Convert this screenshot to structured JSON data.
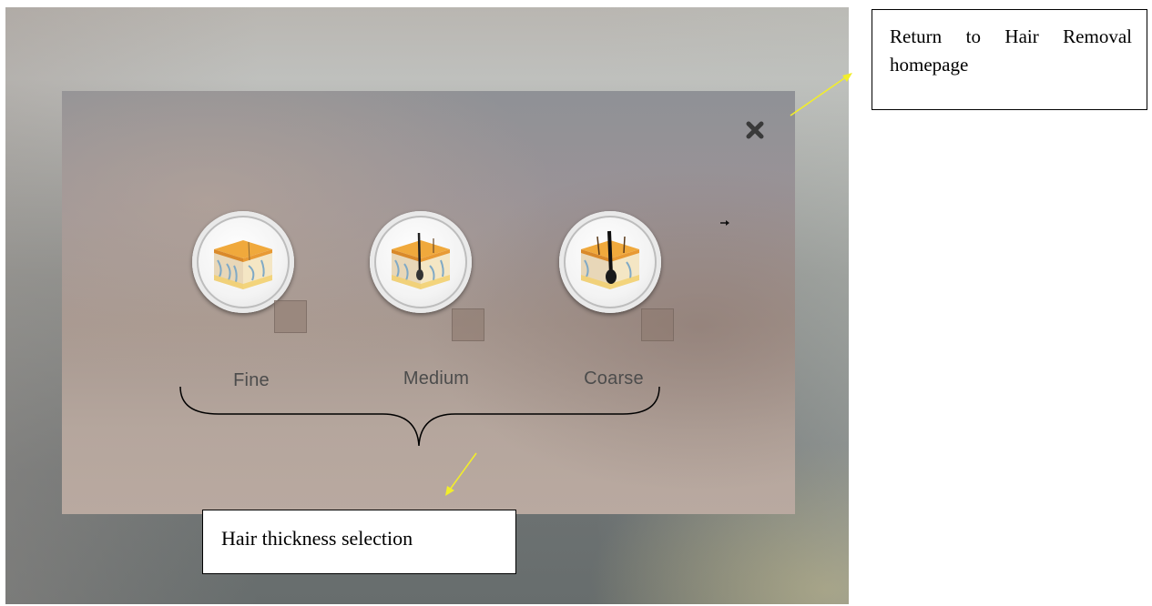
{
  "dialog": {
    "options": [
      {
        "label": "Fine",
        "icon": "skin-fine-hair-icon"
      },
      {
        "label": "Medium",
        "icon": "skin-medium-hair-icon"
      },
      {
        "label": "Coarse",
        "icon": "skin-coarse-hair-icon"
      }
    ],
    "close_icon": "close-icon"
  },
  "annotations": {
    "return_note": "Return to Hair Removal homepage",
    "thickness_note": "Hair thickness selection"
  },
  "colors": {
    "callout_arrow": "#f2ee2a",
    "label_text": "#4c4c4c",
    "skin_top": "#f0a93c"
  }
}
